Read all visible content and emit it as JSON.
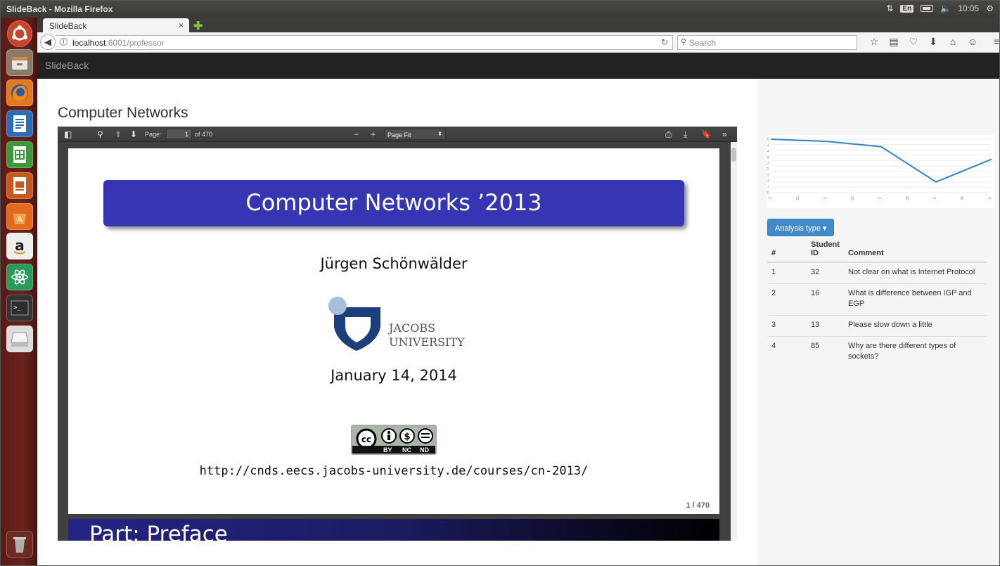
{
  "os": {
    "window_title": "SlideBack - Mozilla Firefox",
    "lang": "En",
    "clock": "10:05"
  },
  "browser": {
    "tab_title": "SlideBack",
    "tab_close": "×",
    "new_tab": "✚",
    "url_host": "localhost",
    "url_path": ":6001/professor",
    "search_placeholder": "Search"
  },
  "app": {
    "brand": "SlideBack",
    "page_title": "Computer Networks"
  },
  "pdf_viewer": {
    "page_label": "Page:",
    "page_current": "1",
    "page_total": "of 470",
    "zoom": "Page Fit",
    "page_number_badge": "1 / 470"
  },
  "slide": {
    "title": "Computer Networks ’2013",
    "author": "Jürgen Schönwälder",
    "logo_line1": "JACOBS",
    "logo_line2": "UNIVERSITY",
    "date": "January 14, 2014",
    "cc_labels": [
      "BY",
      "NC",
      "ND"
    ],
    "url": "http://cnds.eecs.jacobs-university.de/courses/cn-2013/",
    "next_page_title": "Part: Preface"
  },
  "chart_data": {
    "type": "line",
    "x": [
      "1",
      "15",
      "2",
      "25",
      "3",
      "35",
      "4",
      "45",
      "5"
    ],
    "series": [
      {
        "values": [
          5,
          null,
          4.8,
          null,
          4.3,
          null,
          1,
          null,
          3.1
        ]
      }
    ],
    "ylim": [
      0,
      5
    ],
    "yticks": [
      "0",
      "1",
      "1",
      "2",
      "2",
      "3",
      "3",
      "4",
      "4",
      "5"
    ],
    "grid": true,
    "color": "#2e86c8"
  },
  "sidebar": {
    "dropdown_label": "Analysis type",
    "table": {
      "headers": [
        "#",
        "Student ID",
        "Comment"
      ],
      "rows": [
        [
          "1",
          "32",
          "Not clear on what is Internet Protocol"
        ],
        [
          "2",
          "16",
          "What is difference between IGP and EGP"
        ],
        [
          "3",
          "13",
          "Please slow down a little"
        ],
        [
          "4",
          "85",
          "Why are there different types of sockets?"
        ]
      ]
    }
  }
}
